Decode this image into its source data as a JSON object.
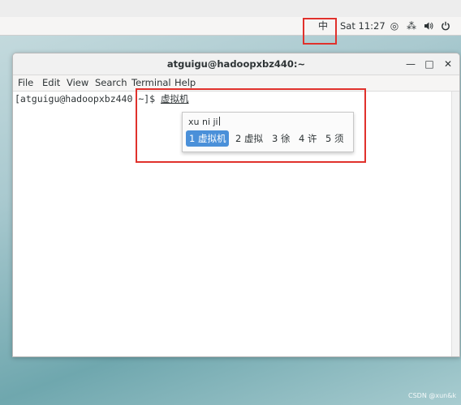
{
  "top_panel": {
    "ime_indicator": "中",
    "clock": "Sat 11:27",
    "icons": [
      "target-icon",
      "network-icon",
      "volume-icon",
      "power-icon"
    ],
    "glyphs": {
      "target": "◎",
      "network": "⁂",
      "volume": "🔊",
      "power": "⏻"
    }
  },
  "window": {
    "title": "atguigu@hadoopxbz440:~",
    "controls": {
      "minimize": "—",
      "maximize": "□",
      "close": "✕"
    },
    "menu": [
      "File",
      "Edit",
      "View",
      "Search",
      "Terminal",
      "Help"
    ]
  },
  "terminal": {
    "prompt": "[atguigu@hadoopxbz440 ~]$ ",
    "preedit_text": "虚拟机"
  },
  "ime_popup": {
    "pinyin": "xu ni ji",
    "candidates": [
      "1 虚拟机",
      "2 虚拟",
      "3 徐",
      "4 许",
      "5 须"
    ],
    "selected_index": 0
  },
  "colors": {
    "highlight": "#e0312c",
    "selected_candidate": "#4a90d9"
  },
  "watermark": "CSDN @xun&k"
}
